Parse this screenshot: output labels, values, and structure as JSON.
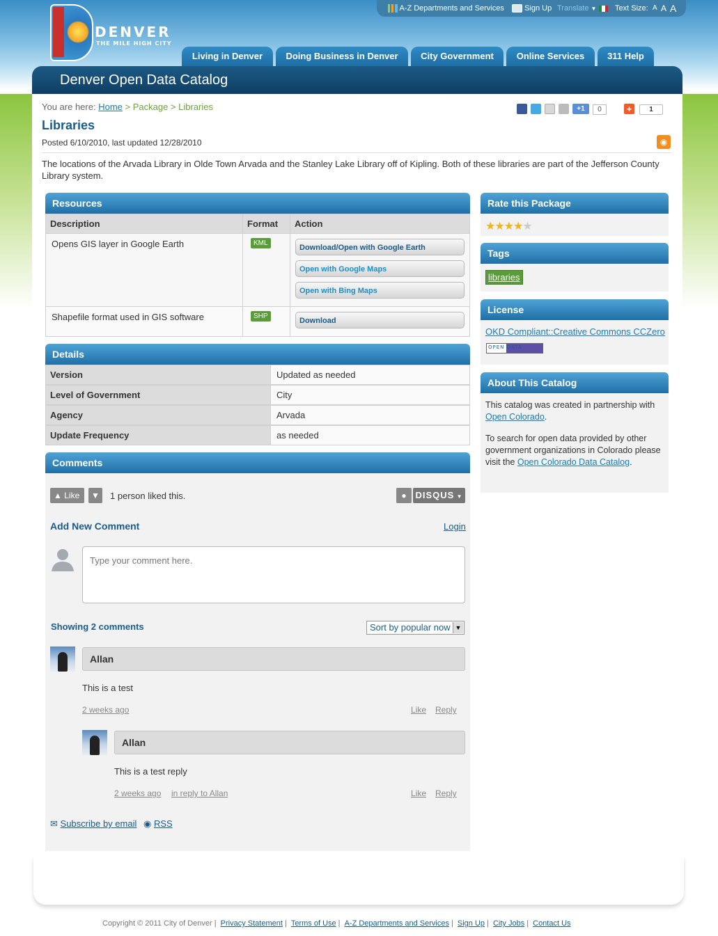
{
  "util": {
    "az": "A-Z Departments and Services",
    "signup": "Sign Up",
    "translate": "Translate",
    "textsize": "Text Size:",
    "sizes": [
      "A",
      "A",
      "A"
    ]
  },
  "logo": {
    "word": "DENVER",
    "tag": "THE MILE HIGH CITY"
  },
  "nav": [
    "Living in Denver",
    "Doing Business in Denver",
    "City Government",
    "Online Services",
    "311 Help"
  ],
  "header_title": "Denver Open Data Catalog",
  "breadcrumb": {
    "prefix": "You are here:",
    "home": "Home",
    "sep1": " > Package > ",
    "current": "Libraries"
  },
  "share": {
    "plusone_count": "0",
    "addthis_count": "1",
    "plusone_label": "+1"
  },
  "page": {
    "title": "Libraries",
    "posted": "Posted 6/10/2010, last updated 12/28/2010",
    "description": "The locations of the Arvada Library in Olde Town Arvada and the Stanley Lake Library off of Kipling. Both of these libraries are part of the Jefferson County Library system."
  },
  "resources": {
    "heading": "Resources",
    "cols": [
      "Description",
      "Format",
      "Action"
    ],
    "rows": [
      {
        "desc": "Opens GIS layer in Google Earth",
        "format": "KML",
        "actions": [
          "Download/Open with Google Earth",
          "Open with Google Maps",
          "Open with Bing Maps"
        ]
      },
      {
        "desc": "Shapefile format used in GIS software",
        "format": "SHP",
        "actions": [
          "Download"
        ]
      }
    ]
  },
  "details": {
    "heading": "Details",
    "rows": [
      {
        "k": "Version",
        "v": "Updated as needed"
      },
      {
        "k": "Level of Government",
        "v": "City"
      },
      {
        "k": "Agency",
        "v": "Arvada"
      },
      {
        "k": "Update Frequency",
        "v": "as needed"
      }
    ]
  },
  "rate": {
    "heading": "Rate this Package",
    "rating": 4,
    "max": 5
  },
  "tags": {
    "heading": "Tags",
    "items": [
      "libraries"
    ]
  },
  "license": {
    "heading": "License",
    "link": "OKD Compliant::Creative Commons CCZero",
    "badge": "OPEN DATA"
  },
  "about": {
    "heading": "About This Catalog",
    "p1": "This catalog was created in partnership with",
    "p1_link": "Open Colorado",
    "p1_end": ".",
    "p2": "To search for open data provided by other government organizations in Colorado please visit the",
    "p2_link": "Open Colorado Data Catalog",
    "p2_end": "."
  },
  "comments": {
    "heading": "Comments",
    "like": "Like",
    "liked_text": "1 person liked this.",
    "disqus": "DISQUS",
    "add_new": "Add New Comment",
    "login": "Login",
    "placeholder": "Type your comment here.",
    "showing": "Showing 2 comments",
    "sort": "Sort by popular now",
    "items": [
      {
        "author": "Allan",
        "text": "This is a test",
        "age": "2 weeks ago",
        "like": "Like",
        "reply": "Reply"
      },
      {
        "author": "Allan",
        "text": "This is a test reply",
        "age": "2 weeks ago",
        "in_reply": "in reply to Allan",
        "like": "Like",
        "reply": "Reply"
      }
    ],
    "subscribe": "Subscribe by email",
    "rss": "RSS"
  },
  "footer": {
    "copyright": "Copyright © 2011 City of Denver |",
    "links": [
      "Privacy Statement",
      "Terms of Use",
      "A-Z Departments and Services",
      "Sign Up",
      "City Jobs",
      "Contact Us"
    ]
  }
}
